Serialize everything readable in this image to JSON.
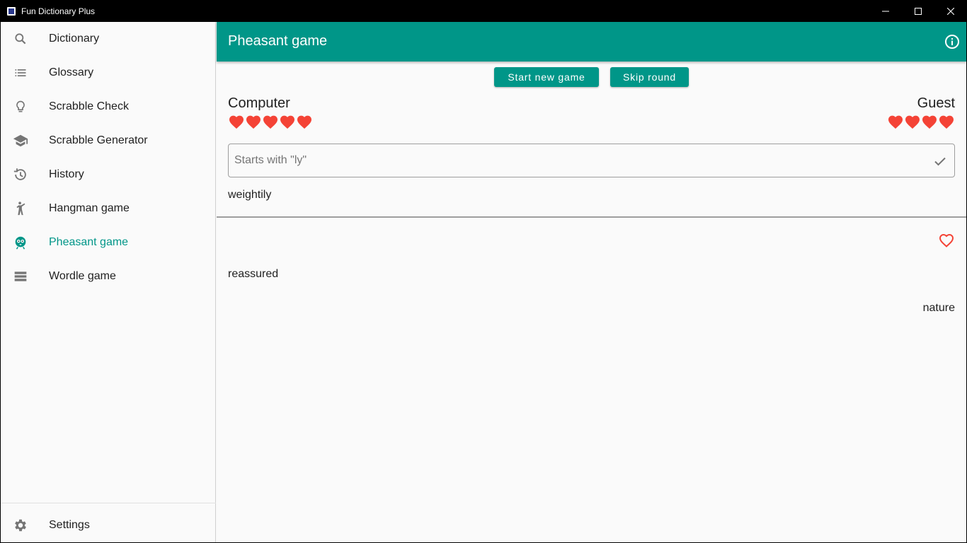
{
  "window": {
    "title": "Fun Dictionary Plus"
  },
  "sidebar": {
    "items": [
      {
        "label": "Dictionary",
        "icon": "search-icon"
      },
      {
        "label": "Glossary",
        "icon": "list-icon"
      },
      {
        "label": "Scrabble Check",
        "icon": "lightbulb-icon"
      },
      {
        "label": "Scrabble Generator",
        "icon": "school-icon"
      },
      {
        "label": "History",
        "icon": "history-icon"
      },
      {
        "label": "Hangman game",
        "icon": "hangman-icon"
      },
      {
        "label": "Pheasant game",
        "icon": "pheasant-icon",
        "active": true
      },
      {
        "label": "Wordle game",
        "icon": "wordle-icon"
      }
    ],
    "settings_label": "Settings"
  },
  "appbar": {
    "title": "Pheasant game"
  },
  "actions": {
    "start_label": "Start new game",
    "skip_label": "Skip round"
  },
  "players": {
    "left": {
      "name": "Computer",
      "lives": 5
    },
    "right": {
      "name": "Guest",
      "lives": 4
    }
  },
  "input": {
    "placeholder": "Starts with \"ly\"",
    "value": ""
  },
  "last_word": "weightily",
  "history": [
    {
      "word": "reassured",
      "side": "left"
    },
    {
      "word": "nature",
      "side": "right"
    }
  ],
  "colors": {
    "accent": "#009688",
    "heart": "#f44336",
    "text": "#212121"
  }
}
